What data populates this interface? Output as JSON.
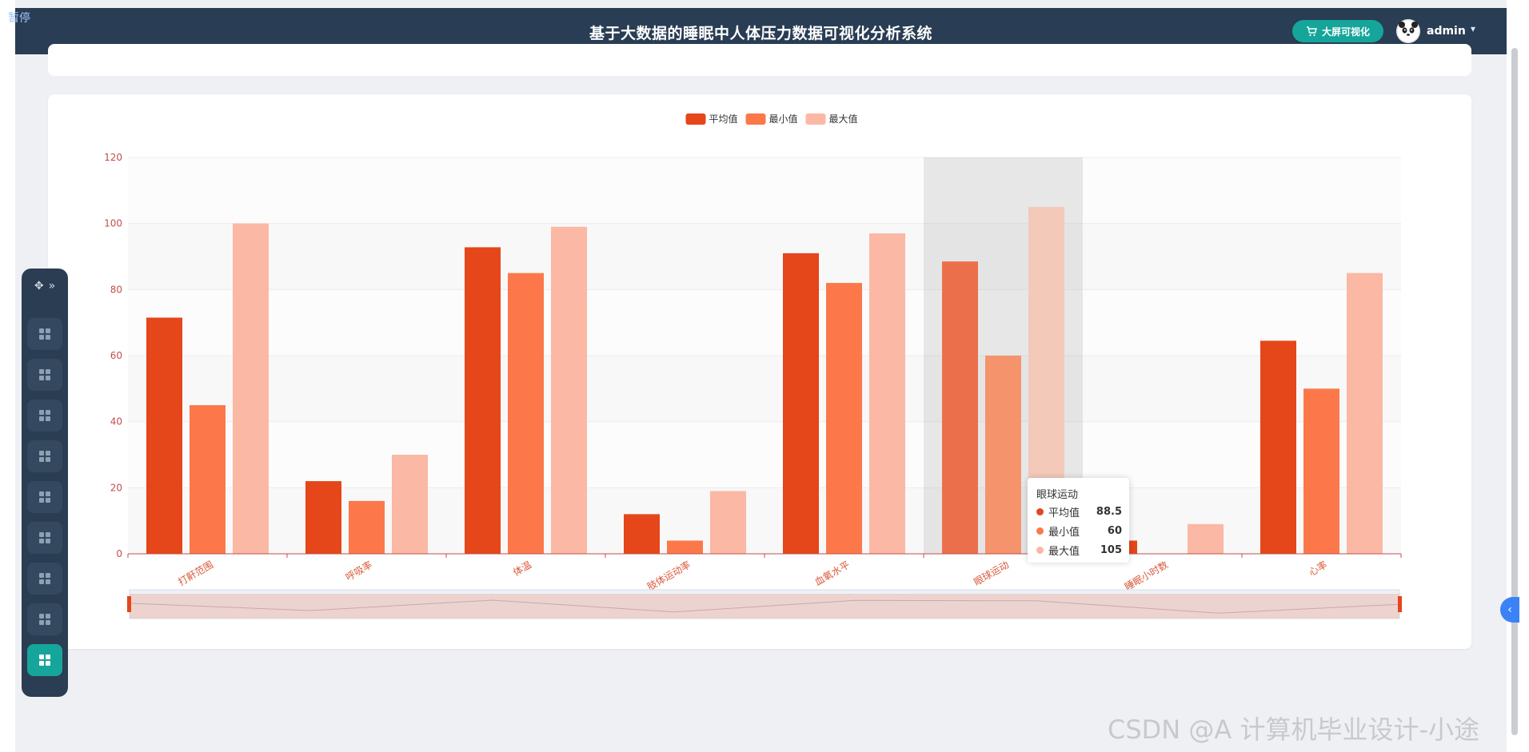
{
  "header": {
    "pause_label": "暂停",
    "title": "基于大数据的睡眠中人体压力数据可视化分析系统",
    "bigscreen_label": "大屏可视化",
    "username": "admin",
    "caret": "▾"
  },
  "sidebar": {
    "head_icons": [
      "move-icon",
      "double-chevron-right-icon"
    ],
    "items": [
      {
        "icon": "grid-icon",
        "active": false
      },
      {
        "icon": "grid-icon",
        "active": false
      },
      {
        "icon": "grid-icon",
        "active": false
      },
      {
        "icon": "grid-icon",
        "active": false
      },
      {
        "icon": "grid-icon",
        "active": false
      },
      {
        "icon": "grid-icon",
        "active": false
      },
      {
        "icon": "grid-icon",
        "active": false
      },
      {
        "icon": "grid-icon",
        "active": false
      },
      {
        "icon": "grid-icon",
        "active": true
      }
    ]
  },
  "chart_data": {
    "type": "bar",
    "categories": [
      "打鼾范围",
      "呼吸率",
      "体温",
      "肢体运动率",
      "血氧水平",
      "眼球运动",
      "睡眠小时数",
      "心率"
    ],
    "series": [
      {
        "name": "平均值",
        "values": [
          71.5,
          22,
          92.8,
          12,
          91,
          88.5,
          4,
          64.5
        ],
        "color": "#e5461a"
      },
      {
        "name": "最小值",
        "values": [
          45,
          16,
          85,
          4,
          82,
          60,
          0,
          50
        ],
        "color": "#fc784a"
      },
      {
        "name": "最大值",
        "values": [
          100,
          30,
          99,
          19,
          97,
          105,
          9,
          85
        ],
        "color": "#fbb8a4"
      }
    ],
    "ylim": [
      0,
      120
    ],
    "yticks": [
      0,
      20,
      40,
      60,
      80,
      100,
      120
    ],
    "legend_position": "top-center",
    "highlighted_category": "眼球运动",
    "datazoom": true
  },
  "tooltip": {
    "title": "眼球运动",
    "rows": [
      {
        "name": "平均值",
        "value": "88.5",
        "color": "#e5461a"
      },
      {
        "name": "最小值",
        "value": "60",
        "color": "#fc784a"
      },
      {
        "name": "最大值",
        "value": "105",
        "color": "#fbb8a4"
      }
    ]
  },
  "watermark": "CSDN @A 计算机毕业设计-小途",
  "side_toggle": "‹"
}
